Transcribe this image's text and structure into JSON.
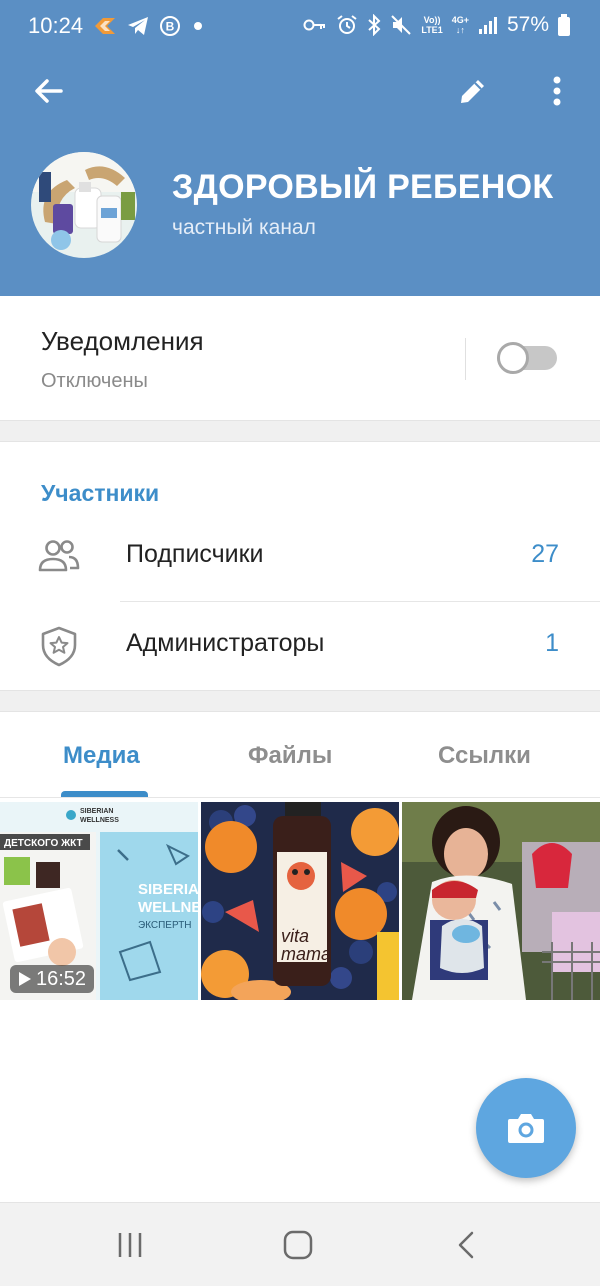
{
  "status_bar": {
    "time": "10:24",
    "battery_percent": "57%",
    "network_label_top": "Vo))",
    "network_label_bottom": "LTE1",
    "network_gen": "4G+",
    "left_icons": [
      "fire-app-icon",
      "telegram-icon",
      "b-badge-icon",
      "dot-icon"
    ],
    "right_icons": [
      "key-icon",
      "alarm-icon",
      "bluetooth-icon",
      "mute-icon",
      "signal-icon",
      "battery-icon"
    ]
  },
  "header": {
    "title": "ЗДОРОВЫЙ РЕБЕНОК",
    "subtitle": "частный канал",
    "icons": [
      "back-arrow-icon",
      "edit-pencil-icon",
      "more-vertical-icon"
    ],
    "color": "#5b8fc4"
  },
  "notifications": {
    "title": "Уведомления",
    "status": "Отключены",
    "enabled": false
  },
  "participants": {
    "section_title": "Участники",
    "rows": [
      {
        "label": "Подписчики",
        "count": "27",
        "icon": "people-icon"
      },
      {
        "label": "Администраторы",
        "count": "1",
        "icon": "admin-shield-icon"
      }
    ]
  },
  "tabs": {
    "items": [
      "Медиа",
      "Файлы",
      "Ссылки"
    ],
    "active_index": 0
  },
  "media": {
    "items": [
      {
        "type": "video",
        "duration": "16:52",
        "brand_line1": "SIBERIAN",
        "brand_line2": "WELLNESS",
        "banner_text": "ДЕТСКОГО ЖКТ",
        "poster_line1": "SIBERIA",
        "poster_line2": "WELLNE",
        "poster_line3": "ЭКСПЕРТН"
      },
      {
        "type": "photo",
        "label_line1": "vita",
        "label_line2": "mama"
      },
      {
        "type": "photo"
      }
    ]
  },
  "fab": {
    "icon": "camera-icon"
  },
  "nav_bar": {
    "icons": [
      "recent-apps-icon",
      "home-icon",
      "back-icon"
    ]
  },
  "accent_color": "#3d8dc9"
}
